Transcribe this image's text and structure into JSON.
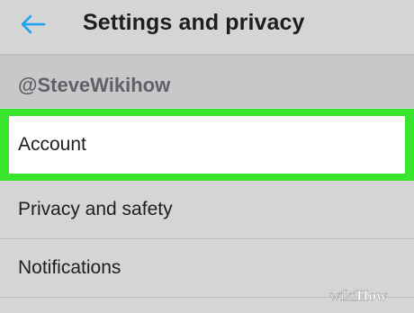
{
  "header": {
    "back_icon": "back-arrow-icon",
    "title": "Settings and privacy"
  },
  "section": {
    "username": "@SteveWikihow"
  },
  "menu": {
    "items": [
      {
        "label": "Account",
        "highlighted": true
      },
      {
        "label": "Privacy and safety"
      },
      {
        "label": "Notifications"
      }
    ]
  },
  "watermark": {
    "text": "wikiHow"
  },
  "colors": {
    "background": "#d5d5d5",
    "section_header": "#c8c8c8",
    "highlight": "#39e62d",
    "accent": "#1da1f2",
    "text": "#1e1e1e",
    "muted_text": "#5e6168"
  }
}
